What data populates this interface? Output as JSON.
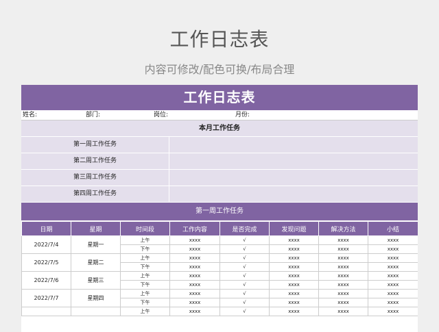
{
  "page": {
    "title": "工作日志表",
    "subtitle": "内容可修改/配色可换/布局合理"
  },
  "sheet": {
    "title": "工作日志表",
    "info": {
      "name_label": "姓名:",
      "dept_label": "部门:",
      "post_label": "岗位:",
      "month_label": "月份:"
    },
    "month_tasks_title": "本月工作任务",
    "weekly_tasks": [
      {
        "label": "第一周工作任务",
        "value": ""
      },
      {
        "label": "第二周工作任务",
        "value": ""
      },
      {
        "label": "第三周工作任务",
        "value": ""
      },
      {
        "label": "第四周工作任务",
        "value": ""
      }
    ],
    "week_section_title": "第一周工作任务",
    "columns": [
      "日期",
      "星期",
      "时间段",
      "工作内容",
      "是否完成",
      "发现问题",
      "解决方法",
      "小结"
    ],
    "days": [
      {
        "date": "2022/7/4",
        "weekday": "星期一",
        "periods": [
          {
            "period": "上午",
            "content": "xxxx",
            "done": "√",
            "issue": "xxxx",
            "solution": "xxxx",
            "summary": "xxxx"
          },
          {
            "period": "下午",
            "content": "xxxx",
            "done": "√",
            "issue": "xxxx",
            "solution": "xxxx",
            "summary": "xxxx"
          }
        ]
      },
      {
        "date": "2022/7/5",
        "weekday": "星期二",
        "periods": [
          {
            "period": "上午",
            "content": "xxxx",
            "done": "√",
            "issue": "xxxx",
            "solution": "xxxx",
            "summary": "xxxx"
          },
          {
            "period": "下午",
            "content": "xxxx",
            "done": "√",
            "issue": "xxxx",
            "solution": "xxxx",
            "summary": "xxxx"
          }
        ]
      },
      {
        "date": "2022/7/6",
        "weekday": "星期三",
        "periods": [
          {
            "period": "上午",
            "content": "xxxx",
            "done": "√",
            "issue": "xxxx",
            "solution": "xxxx",
            "summary": "xxxx"
          },
          {
            "period": "下午",
            "content": "xxxx",
            "done": "√",
            "issue": "xxxx",
            "solution": "xxxx",
            "summary": "xxxx"
          }
        ]
      },
      {
        "date": "2022/7/7",
        "weekday": "星期四",
        "periods": [
          {
            "period": "上午",
            "content": "xxxx",
            "done": "√",
            "issue": "xxxx",
            "solution": "xxxx",
            "summary": "xxxx"
          },
          {
            "period": "下午",
            "content": "xxxx",
            "done": "√",
            "issue": "xxxx",
            "solution": "xxxx",
            "summary": "xxxx"
          }
        ]
      },
      {
        "date": "",
        "weekday": "",
        "periods": [
          {
            "period": "上午",
            "content": "xxxx",
            "done": "√",
            "issue": "xxxx",
            "solution": "xxxx",
            "summary": "xxxx"
          }
        ]
      }
    ]
  },
  "colors": {
    "accent": "#8064a2",
    "light_band": "#e4dfec",
    "background": "#efefef"
  }
}
